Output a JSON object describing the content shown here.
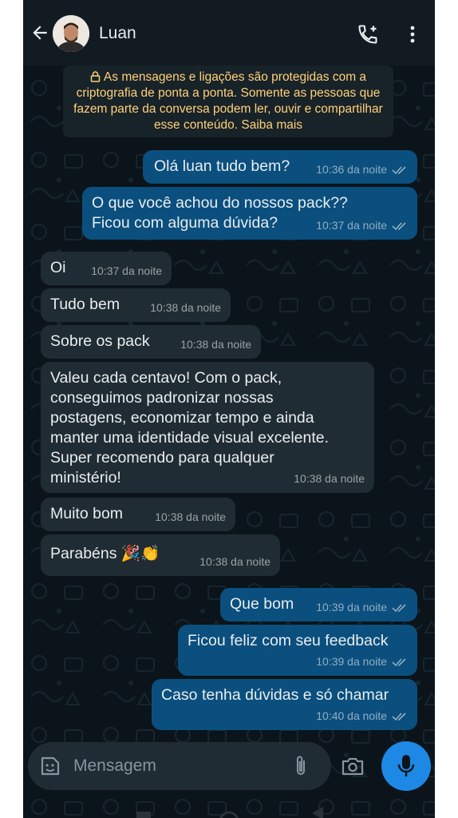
{
  "header": {
    "contact_name": "Luan"
  },
  "encryption_notice": "As mensagens e ligações são protegidas com a criptografia de ponta a ponta. Somente as pessoas que fazem parte da conversa podem ler, ouvir e compartilhar esse conteúdo. Saiba mais",
  "messages": [
    {
      "dir": "out",
      "text": "Olá luan tudo bem?",
      "time": "10:36 da noite"
    },
    {
      "dir": "out",
      "text": "O que você achou do nossos pack??\nFicou com alguma dúvida?",
      "time": "10:37 da noite"
    },
    {
      "dir": "in",
      "text": "Oi",
      "time": "10:37 da noite"
    },
    {
      "dir": "in",
      "text": "Tudo bem",
      "time": "10:38 da noite"
    },
    {
      "dir": "in",
      "text": "Sobre os pack",
      "time": "10:38 da noite"
    },
    {
      "dir": "in",
      "text": "Valeu cada centavo! Com o pack,\nconseguimos padronizar nossas\npostagens, economizar tempo e ainda\nmanter uma identidade visual excelente.\nSuper recomendo para qualquer\nministério!",
      "time": "10:38 da noite"
    },
    {
      "dir": "in",
      "text": "Muito bom",
      "time": "10:38 da noite"
    },
    {
      "dir": "in",
      "text": "Parabéns 🎉👏",
      "time": "10:38 da noite"
    },
    {
      "dir": "out",
      "text": "Que bom",
      "time": "10:39 da noite"
    },
    {
      "dir": "out",
      "text": "Ficou feliz com seu feedback",
      "time": "10:39 da noite"
    },
    {
      "dir": "out",
      "text": "Caso tenha dúvidas e só chamar",
      "time": "10:40 da noite"
    }
  ],
  "input": {
    "placeholder": "Mensagem"
  },
  "colors": {
    "background": "#0b141a",
    "header": "#111b21",
    "outgoing_bubble": "#0a4f7e",
    "incoming_bubble": "#202c33",
    "notice_text": "#ffd279",
    "mic_button": "#1e88e5"
  }
}
